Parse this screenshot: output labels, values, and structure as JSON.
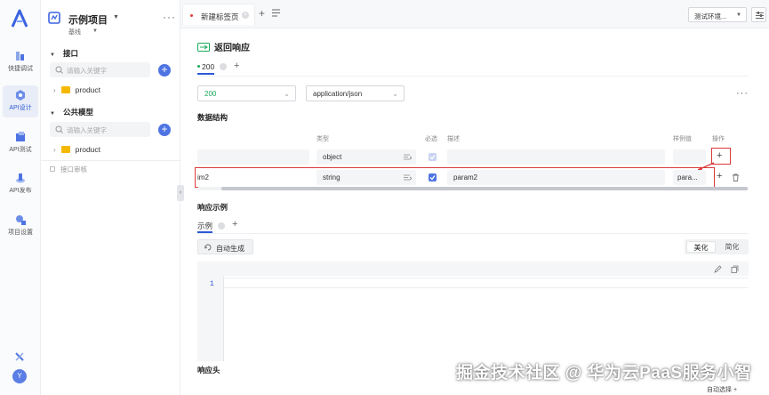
{
  "rail": {
    "items": [
      {
        "label": "快捷调试"
      },
      {
        "label": "API设计"
      },
      {
        "label": "API测试"
      },
      {
        "label": "API发布"
      },
      {
        "label": "项目设置"
      }
    ],
    "avatar_letter": "Y"
  },
  "sidebar": {
    "project_name": "示例项目",
    "branch": "基线",
    "sections": [
      {
        "title": "接口",
        "search_placeholder": "请输入关键字",
        "item": "product"
      },
      {
        "title": "公共模型",
        "search_placeholder": "请输入关键字",
        "item": "product"
      }
    ],
    "audit": "接口审核"
  },
  "tabs": {
    "active_tab": "新建标签页",
    "env": "测试环境..."
  },
  "main": {
    "title": "返回响应",
    "status_tab": "200",
    "status_select": "200",
    "content_type": "application/json",
    "data_structure_label": "数据结构",
    "columns": {
      "type": "类型",
      "required": "必选",
      "desc": "描述",
      "example": "样例值",
      "ops": "操作"
    },
    "rows": [
      {
        "name": "",
        "type": "object",
        "desc": "",
        "example": ""
      },
      {
        "name": "im2",
        "type": "string",
        "desc": "param2",
        "example": "para..."
      }
    ],
    "response_example_label": "响应示例",
    "example_tab": "示例",
    "auto_generate": "自动生成",
    "beautify": "美化",
    "simplify": "简化",
    "line_number": "1",
    "response_header_label": "响应头"
  },
  "footer": {
    "watermark": "掘金技术社区 @ 华为云PaaS服务小智",
    "auto_select": "自动选择 +"
  },
  "colors": {
    "accent": "#2b59d6",
    "success": "#1aac5a",
    "highlight": "#d93a3a"
  }
}
